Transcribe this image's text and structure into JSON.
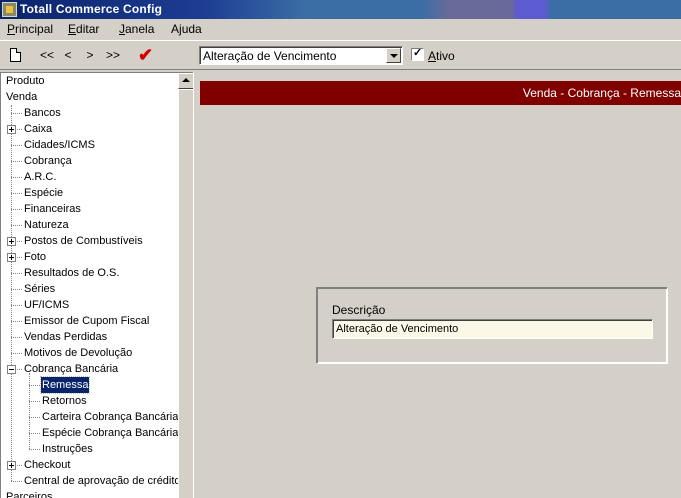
{
  "window": {
    "title": "Totall Commerce Config"
  },
  "menu": {
    "items": [
      {
        "label": "Principal",
        "accel": "P"
      },
      {
        "label": "Editar",
        "accel": "E"
      },
      {
        "label": "Janela",
        "accel": "J"
      },
      {
        "label": "Ajuda",
        "accel": "j"
      }
    ]
  },
  "toolbar": {
    "first_label": "<<",
    "prev_label": "<",
    "next_label": ">",
    "last_label": ">>",
    "select_value": "Alteração de Vencimento",
    "active_label": "Ativo",
    "active_checked": true,
    "accent_color": "#d40000"
  },
  "tree": {
    "items": [
      {
        "label": "Produto",
        "level": 0
      },
      {
        "label": "Venda",
        "level": 0
      },
      {
        "label": "Bancos",
        "level": 1
      },
      {
        "label": "Caixa",
        "level": 1,
        "expander": "plus"
      },
      {
        "label": "Cidades/ICMS",
        "level": 1
      },
      {
        "label": "Cobrança",
        "level": 1
      },
      {
        "label": "A.R.C.",
        "level": 1
      },
      {
        "label": "Espécie",
        "level": 1
      },
      {
        "label": "Financeiras",
        "level": 1
      },
      {
        "label": "Natureza",
        "level": 1
      },
      {
        "label": "Postos de Combustíveis",
        "level": 1,
        "expander": "plus"
      },
      {
        "label": "Foto",
        "level": 1,
        "expander": "plus"
      },
      {
        "label": "Resultados de O.S.",
        "level": 1
      },
      {
        "label": "Séries",
        "level": 1
      },
      {
        "label": "UF/ICMS",
        "level": 1
      },
      {
        "label": "Emissor de Cupom Fiscal",
        "level": 1
      },
      {
        "label": "Vendas Perdidas",
        "level": 1
      },
      {
        "label": "Motivos de Devolução",
        "level": 1
      },
      {
        "label": "Cobrança Bancária",
        "level": 1,
        "expander": "minus"
      },
      {
        "label": "Remessa",
        "level": 2,
        "selected": true
      },
      {
        "label": "Retornos",
        "level": 2
      },
      {
        "label": "Carteira Cobrança Bancária",
        "level": 2
      },
      {
        "label": "Espécie Cobrança Bancária",
        "level": 2
      },
      {
        "label": "Instruções",
        "level": 2
      },
      {
        "label": "Checkout",
        "level": 1,
        "expander": "plus"
      },
      {
        "label": "Central de aprovação de crédito",
        "level": 1
      },
      {
        "label": "Parceiros",
        "level": 0
      }
    ]
  },
  "content": {
    "breadcrumb": "Venda - Cobrança - Remessa",
    "description_label": "Descrição",
    "description_value": "Alteração de Vencimento",
    "banner_color": "#800000"
  }
}
